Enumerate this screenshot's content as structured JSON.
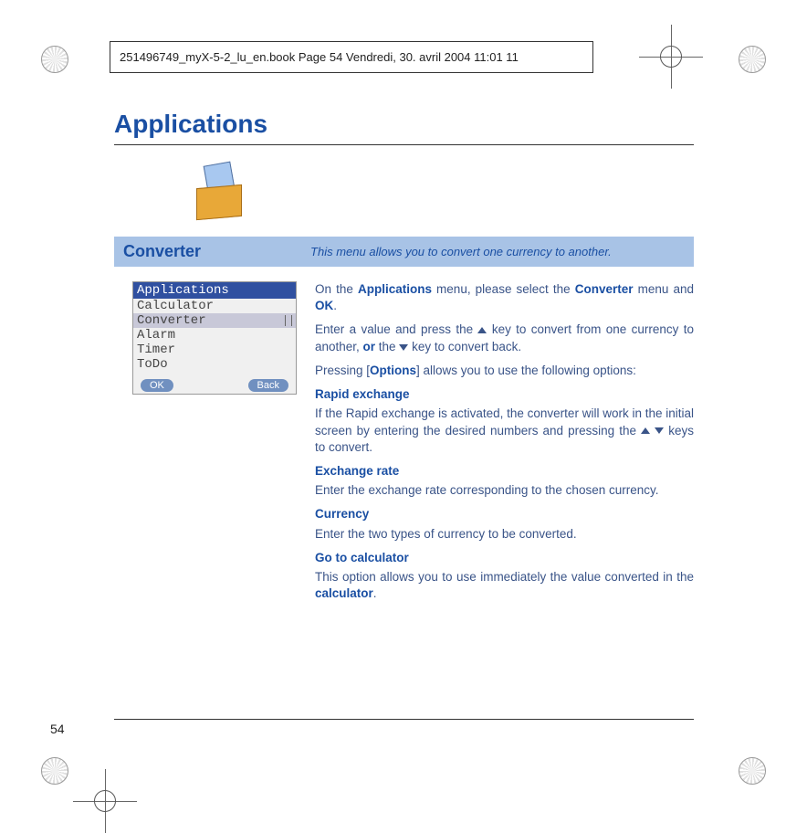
{
  "printer_bar": "251496749_myX-5-2_lu_en.book  Page 54  Vendredi, 30. avril 2004  11:01 11",
  "heading": "Applications",
  "section": {
    "title": "Converter",
    "desc": "This menu allows you to convert one currency to another."
  },
  "phone": {
    "title": "Applications",
    "items": [
      "Calculator",
      "Converter",
      "Alarm",
      "Timer",
      "ToDo"
    ],
    "selected_index": 1,
    "softkey_left": "OK",
    "softkey_right": "Back"
  },
  "body": {
    "p1_a": "On the ",
    "p1_b": "Applications",
    "p1_c": " menu, please select the ",
    "p1_d": "Converter",
    "p1_e": " menu and ",
    "p1_f": "OK",
    "p1_g": ".",
    "p2_a": "Enter a value and press the ",
    "p2_b": " key to convert from one currency to another, ",
    "p2_c": "or",
    "p2_d": " the ",
    "p2_e": " key to convert back.",
    "p3_a": "Pressing [",
    "p3_b": "Options",
    "p3_c": "] allows you to use the following options:",
    "h_rapid": "Rapid exchange",
    "p_rapid": "If the Rapid exchange is activated, the converter will work in the initial screen by entering the desired numbers and pressing the ",
    "p_rapid_end": " keys to convert.",
    "h_rate": "Exchange rate",
    "p_rate": "Enter the exchange rate corresponding to the chosen currency.",
    "h_curr": "Currency",
    "p_curr": "Enter the two types of currency to be converted.",
    "h_calc": "Go to calculator",
    "p_calc_a": "This option allows you to use immediately the value converted in the ",
    "p_calc_b": "calculator",
    "p_calc_c": "."
  },
  "pagenum": "54"
}
